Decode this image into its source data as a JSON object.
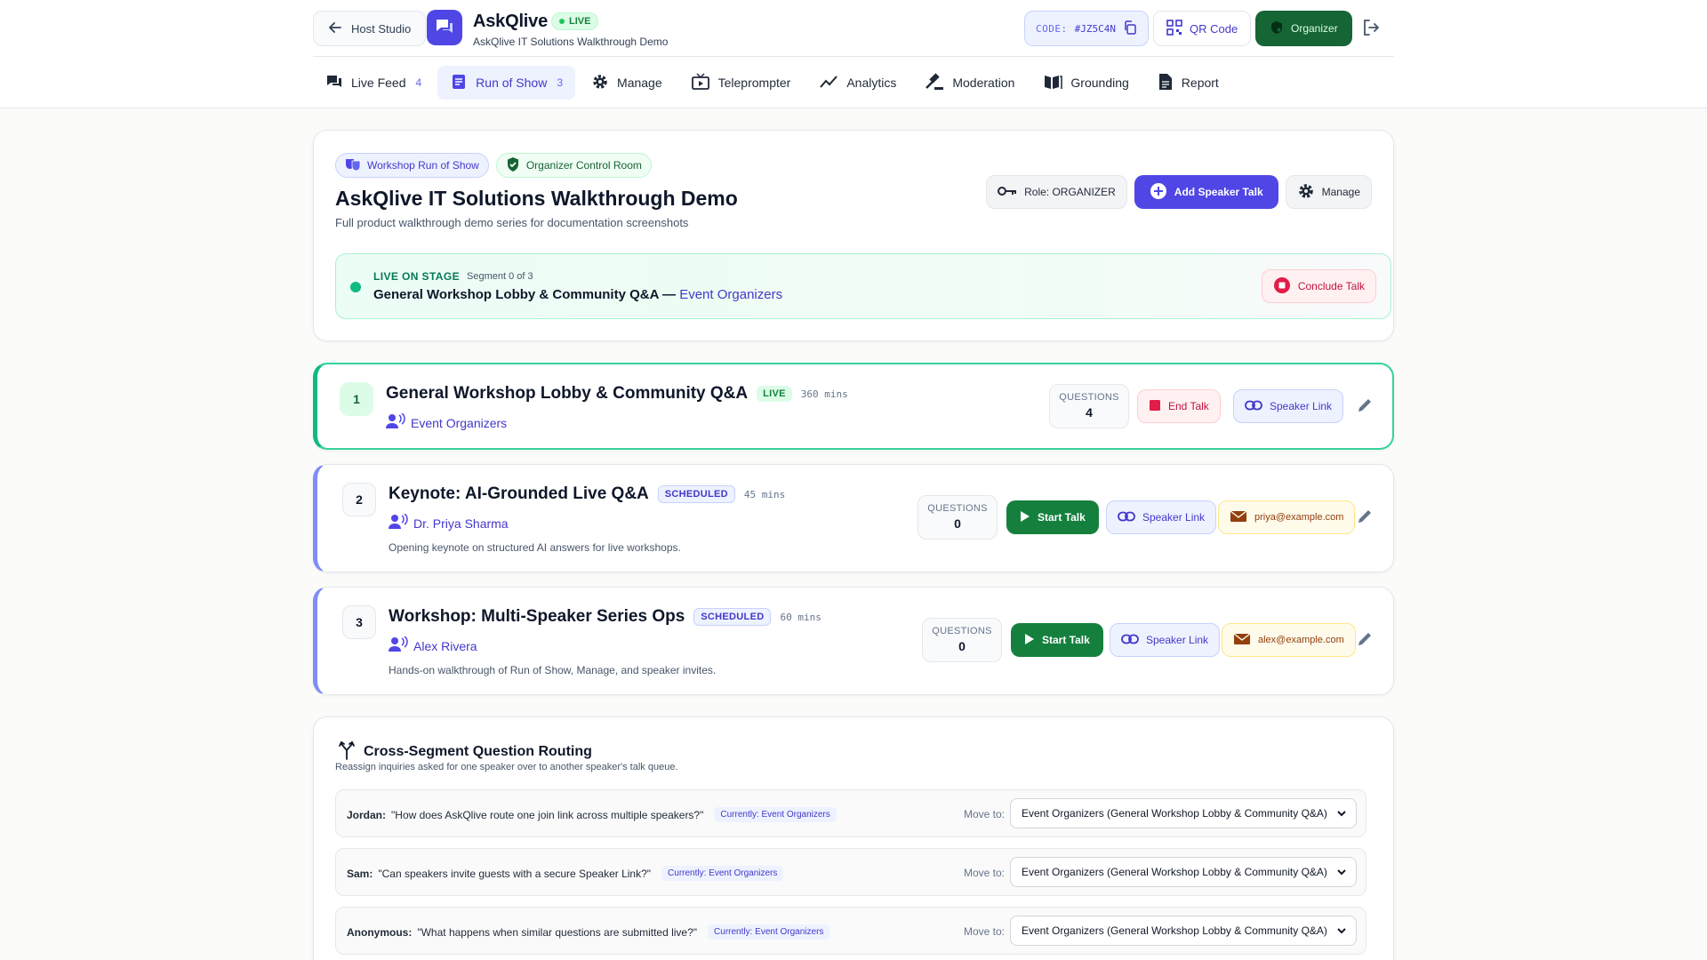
{
  "header": {
    "host_studio": "Host Studio",
    "app_name": "AskQlive",
    "live_label": "LIVE",
    "subtitle": "AskQlive IT Solutions Walkthrough Demo",
    "code_label": "CODE:",
    "code_value": "#JZ5C4N",
    "qr_label": "QR Code",
    "organizer_label": "Organizer"
  },
  "tabs": [
    {
      "label": "Live Feed",
      "count": "4",
      "icon": "chat-icon"
    },
    {
      "label": "Run of Show",
      "count": "3",
      "icon": "list-icon",
      "active": true
    },
    {
      "label": "Manage",
      "icon": "gear-icon"
    },
    {
      "label": "Teleprompter",
      "icon": "tv-icon"
    },
    {
      "label": "Analytics",
      "icon": "trend-icon"
    },
    {
      "label": "Moderation",
      "icon": "gavel-icon"
    },
    {
      "label": "Grounding",
      "icon": "book-icon"
    },
    {
      "label": "Report",
      "icon": "report-icon"
    }
  ],
  "event": {
    "pill_run_of_show": "Workshop Run of Show",
    "pill_control_room": "Organizer Control Room",
    "title": "AskQlive IT Solutions Walkthrough Demo",
    "description": "Full product walkthrough demo series for documentation screenshots",
    "role_label": "Role: ORGANIZER",
    "add_talk_label": "Add Speaker Talk",
    "manage_label": "Manage"
  },
  "live_banner": {
    "label": "LIVE ON STAGE",
    "segment": "Segment 0 of 3",
    "talk": "General Workshop Lobby & Community Q&A —",
    "speaker": "Event Organizers",
    "conclude_label": "Conclude Talk"
  },
  "segments": [
    {
      "number": "1",
      "title": "General Workshop Lobby & Community Q&A",
      "status": "LIVE",
      "duration": "360 mins",
      "speaker": "Event Organizers",
      "description": "",
      "questions_label": "QUESTIONS",
      "questions": "4",
      "action_label": "End Talk",
      "link_label": "Speaker Link"
    },
    {
      "number": "2",
      "title": "Keynote: AI-Grounded Live Q&A",
      "status": "SCHEDULED",
      "duration": "45 mins",
      "speaker": "Dr. Priya Sharma",
      "description": "Opening keynote on structured AI answers for live workshops.",
      "questions_label": "QUESTIONS",
      "questions": "0",
      "action_label": "Start Talk",
      "link_label": "Speaker Link",
      "email": "priya@example.com"
    },
    {
      "number": "3",
      "title": "Workshop: Multi-Speaker Series Ops",
      "status": "SCHEDULED",
      "duration": "60 mins",
      "speaker": "Alex Rivera",
      "description": "Hands-on walkthrough of Run of Show, Manage, and speaker invites.",
      "questions_label": "QUESTIONS",
      "questions": "0",
      "action_label": "Start Talk",
      "link_label": "Speaker Link",
      "email": "alex@example.com"
    }
  ],
  "routing": {
    "title": "Cross-Segment Question Routing",
    "subtitle": "Reassign inquiries asked for one speaker over to another speaker's talk queue.",
    "move_to_label": "Move to:",
    "rows": [
      {
        "asker": "Jordan:",
        "question": "\"How does AskQlive route one join link across multiple speakers?\"",
        "current": "Currently: Event Organizers",
        "selected": "Event Organizers (General Workshop Lobby & Community Q&A)"
      },
      {
        "asker": "Sam:",
        "question": "\"Can speakers invite guests with a secure Speaker Link?\"",
        "current": "Currently: Event Organizers",
        "selected": "Event Organizers (General Workshop Lobby & Community Q&A)"
      },
      {
        "asker": "Anonymous:",
        "question": "\"What happens when similar questions are submitted live?\"",
        "current": "Currently: Event Organizers",
        "selected": "Event Organizers (General Workshop Lobby & Community Q&A)"
      }
    ]
  },
  "colors": {
    "accent": "#4f46e5",
    "live_green": "#15803d",
    "scheduled_bar": "#818cf8"
  }
}
